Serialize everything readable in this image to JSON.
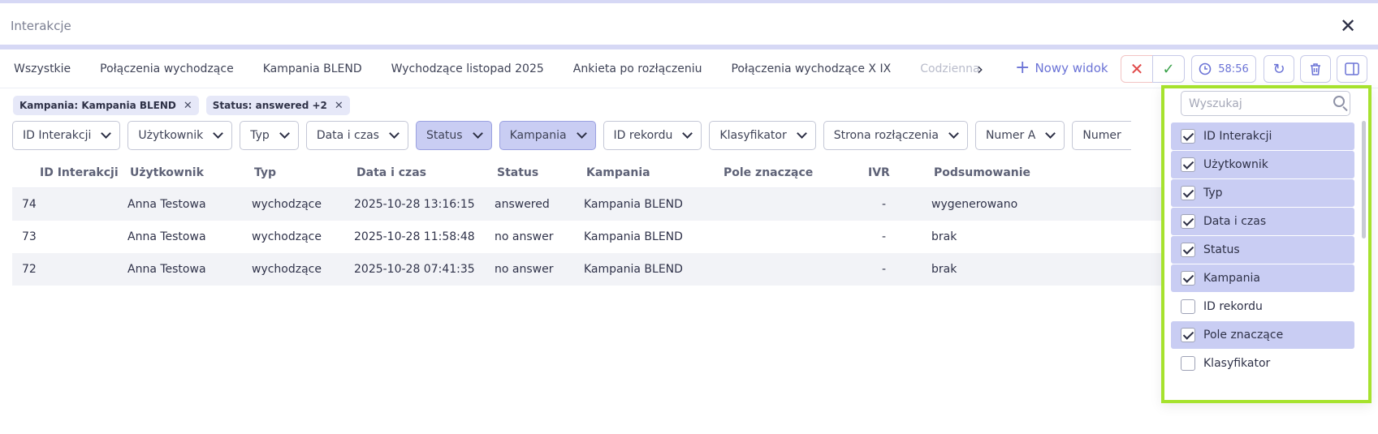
{
  "window": {
    "title": "Interakcje"
  },
  "tabs": [
    "Wszystkie",
    "Połączenia wychodzące",
    "Kampania BLEND",
    "Wychodzące listopad 2025",
    "Ankieta po rozłączeniu",
    "Połączenia wychodzące X IX",
    "Codzienna"
  ],
  "toolbar": {
    "new_view_label": "Nowy widok",
    "timer": "58:56"
  },
  "active_filters": [
    "Kampania: Kampania BLEND",
    "Status: answered +2"
  ],
  "filter_buttons": [
    {
      "label": "ID Interakcji",
      "active": false
    },
    {
      "label": "Użytkownik",
      "active": false
    },
    {
      "label": "Typ",
      "active": false
    },
    {
      "label": "Data i czas",
      "active": false
    },
    {
      "label": "Status",
      "active": true
    },
    {
      "label": "Kampania",
      "active": true
    },
    {
      "label": "ID rekordu",
      "active": false
    },
    {
      "label": "Klasyfikator",
      "active": false
    },
    {
      "label": "Strona rozłączenia",
      "active": false
    },
    {
      "label": "Numer A",
      "active": false
    },
    {
      "label": "Numer",
      "active": false
    }
  ],
  "table": {
    "columns": [
      "ID Interakcji",
      "Użytkownik",
      "Typ",
      "Data i czas",
      "Status",
      "Kampania",
      "Pole znaczące",
      "IVR",
      "Podsumowanie"
    ],
    "rows": [
      [
        "74",
        "Anna Testowa",
        "wychodzące",
        "2025-10-28 13:16:15",
        "answered",
        "Kampania BLEND",
        "",
        "-",
        "wygenerowano"
      ],
      [
        "73",
        "Anna Testowa",
        "wychodzące",
        "2025-10-28 11:58:48",
        "no answer",
        "Kampania BLEND",
        "",
        "-",
        "brak"
      ],
      [
        "72",
        "Anna Testowa",
        "wychodzące",
        "2025-10-28 07:41:35",
        "no answer",
        "Kampania BLEND",
        "",
        "-",
        "brak"
      ]
    ]
  },
  "column_picker": {
    "search_placeholder": "Wyszukaj",
    "items": [
      {
        "label": "ID Interakcji",
        "checked": true
      },
      {
        "label": "Użytkownik",
        "checked": true
      },
      {
        "label": "Typ",
        "checked": true
      },
      {
        "label": "Data i czas",
        "checked": true
      },
      {
        "label": "Status",
        "checked": true
      },
      {
        "label": "Kampania",
        "checked": true
      },
      {
        "label": "ID rekordu",
        "checked": false
      },
      {
        "label": "Pole znaczące",
        "checked": true
      },
      {
        "label": "Klasyfikator",
        "checked": false
      }
    ]
  },
  "colors": {
    "accent": "#6b73d6",
    "selected_bg": "#c9cdf3",
    "highlight_border": "#a6e22e",
    "reject": "#e04848",
    "accept": "#3aa24a"
  }
}
